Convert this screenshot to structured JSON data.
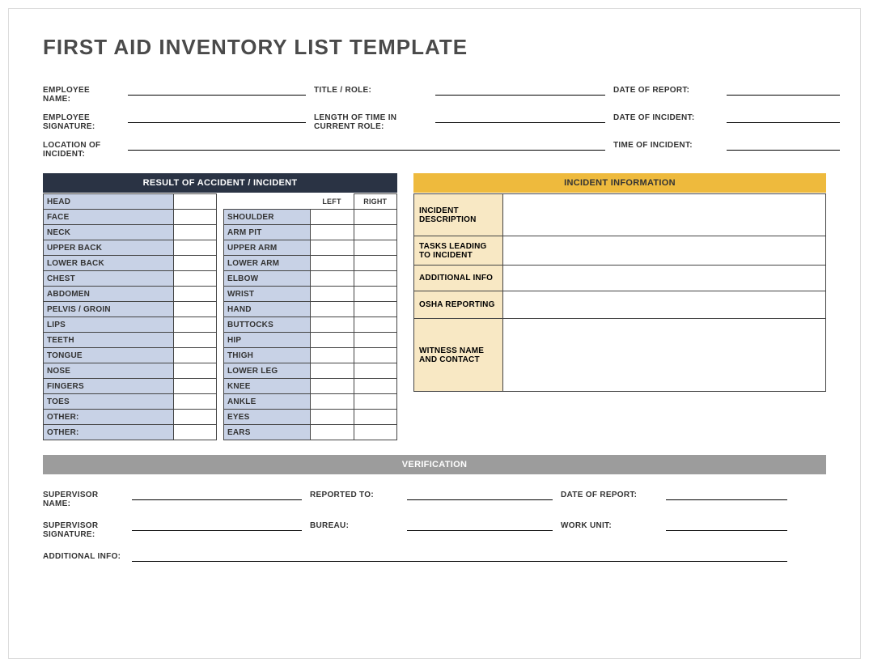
{
  "title": "FIRST AID INVENTORY LIST TEMPLATE",
  "meta": {
    "row1": {
      "employee_name_lbl": "EMPLOYEE NAME:",
      "title_role_lbl": "TITLE / ROLE:",
      "date_report_lbl": "DATE OF REPORT:"
    },
    "row2": {
      "employee_sig_lbl": "EMPLOYEE SIGNATURE:",
      "length_role_lbl": "LENGTH OF TIME IN CURRENT ROLE:",
      "date_incident_lbl": "DATE OF INCIDENT:"
    },
    "row3": {
      "location_lbl": "LOCATION OF INCIDENT:",
      "time_incident_lbl": "TIME OF INCIDENT:"
    }
  },
  "result_header": "RESULT OF ACCIDENT / INCIDENT",
  "lr_headers": {
    "left": "LEFT",
    "right": "RIGHT"
  },
  "body_left": [
    "HEAD",
    "FACE",
    "NECK",
    "UPPER BACK",
    "LOWER BACK",
    "CHEST",
    "ABDOMEN",
    "PELVIS / GROIN",
    "LIPS",
    "TEETH",
    "TONGUE",
    "NOSE",
    "FINGERS",
    "TOES",
    "OTHER:",
    "OTHER:"
  ],
  "body_right": [
    "SHOULDER",
    "ARM PIT",
    "UPPER ARM",
    "LOWER ARM",
    "ELBOW",
    "WRIST",
    "HAND",
    "BUTTOCKS",
    "HIP",
    "THIGH",
    "LOWER LEG",
    "KNEE",
    "ANKLE",
    "EYES",
    "EARS"
  ],
  "incident_header": "INCIDENT INFORMATION",
  "incident_rows": [
    {
      "label": "INCIDENT DESCRIPTION",
      "h": 52
    },
    {
      "label": "TASKS LEADING TO INCIDENT",
      "h": 36
    },
    {
      "label": "ADDITIONAL INFO",
      "h": 32
    },
    {
      "label": "OSHA REPORTING",
      "h": 34
    },
    {
      "label": "WITNESS NAME AND CONTACT",
      "h": 90
    }
  ],
  "verification_header": "VERIFICATION",
  "ver": {
    "sup_name_lbl": "SUPERVISOR NAME:",
    "reported_to_lbl": "REPORTED TO:",
    "date_report_lbl": "DATE OF REPORT:",
    "sup_sig_lbl": "SUPERVISOR SIGNATURE:",
    "bureau_lbl": "BUREAU:",
    "work_unit_lbl": "WORK UNIT:",
    "add_info_lbl": "ADDITIONAL INFO:"
  }
}
